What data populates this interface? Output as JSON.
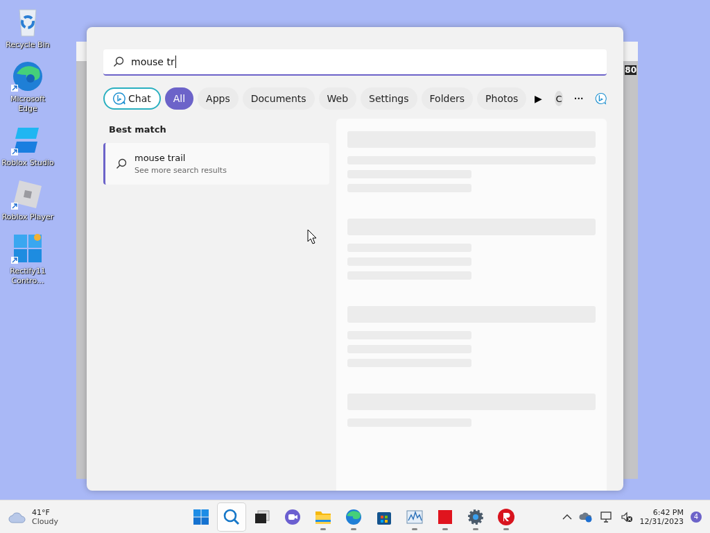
{
  "desktop_icons": [
    {
      "kind": "recycle",
      "label": "Recycle Bin",
      "shortcut": false
    },
    {
      "kind": "edge",
      "label": "Microsoft Edge",
      "shortcut": true
    },
    {
      "kind": "studio",
      "label": "Roblox Studio",
      "shortcut": true
    },
    {
      "kind": "player",
      "label": "Roblox Player",
      "shortcut": true
    },
    {
      "kind": "rectify",
      "label": "Rectify11 Contro...",
      "shortcut": true
    }
  ],
  "background_window": {
    "badge": "80"
  },
  "search": {
    "value": "mouse tr"
  },
  "filters": [
    {
      "kind": "chat",
      "label": "Chat",
      "selected": false
    },
    {
      "kind": "pill",
      "label": "All",
      "selected": true
    },
    {
      "kind": "pill",
      "label": "Apps",
      "selected": false
    },
    {
      "kind": "pill",
      "label": "Documents",
      "selected": false
    },
    {
      "kind": "pill",
      "label": "Web",
      "selected": false
    },
    {
      "kind": "pill",
      "label": "Settings",
      "selected": false
    },
    {
      "kind": "pill",
      "label": "Folders",
      "selected": false
    },
    {
      "kind": "pill",
      "label": "Photos",
      "selected": false
    }
  ],
  "scroll_arrow": "▶",
  "account_initial": "C",
  "more": "···",
  "best_match": {
    "heading": "Best match",
    "title": "mouse trail",
    "subtitle": "See more search results",
    "selected": true
  },
  "weather": {
    "temp": "41°F",
    "condition": "Cloudy"
  },
  "taskbar_apps": [
    {
      "kind": "start",
      "running": false,
      "selected": false
    },
    {
      "kind": "search",
      "running": false,
      "selected": true
    },
    {
      "kind": "taskview",
      "running": false,
      "selected": false
    },
    {
      "kind": "chat",
      "running": false,
      "selected": false
    },
    {
      "kind": "folder",
      "running": true,
      "selected": false
    },
    {
      "kind": "edge",
      "running": true,
      "selected": false
    },
    {
      "kind": "store",
      "running": false,
      "selected": false
    },
    {
      "kind": "monitor",
      "running": true,
      "selected": false
    },
    {
      "kind": "red",
      "running": true,
      "selected": false
    },
    {
      "kind": "settings",
      "running": true,
      "selected": false
    },
    {
      "kind": "roblox",
      "running": true,
      "selected": false
    }
  ],
  "clock": {
    "time": "6:42 PM",
    "date": "12/31/2023",
    "notifications": "4"
  }
}
